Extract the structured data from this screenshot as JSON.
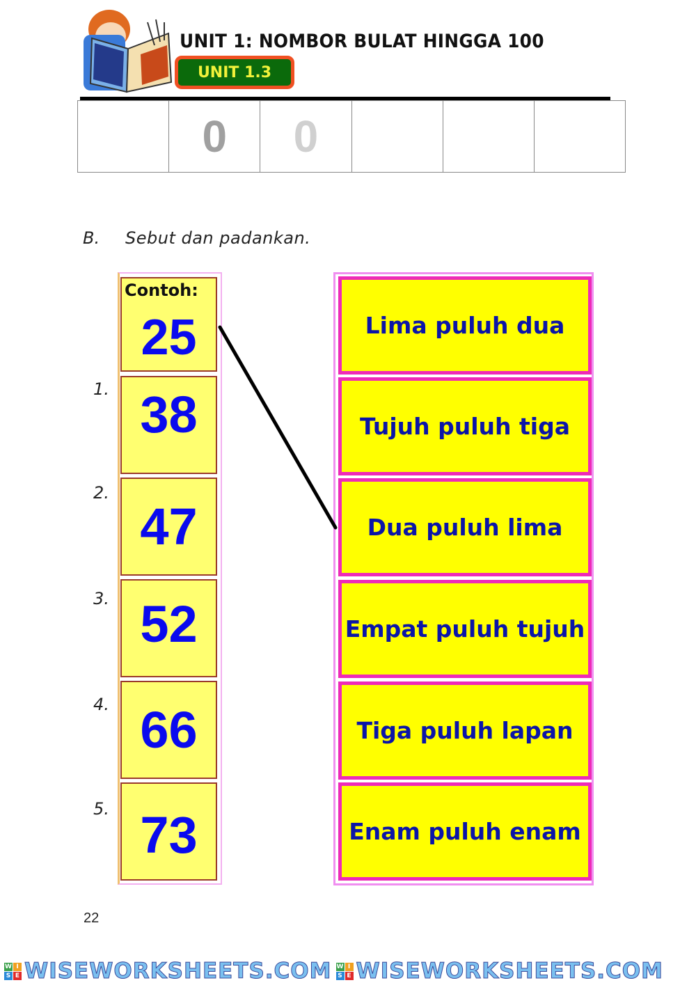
{
  "header": {
    "title": "UNIT 1: NOMBOR BULAT HINGGA 100",
    "badge": "UNIT 1.3",
    "illustration": "boy-reading-book-icon"
  },
  "place_value_table": {
    "cells": [
      "",
      "0",
      "0",
      "",
      "",
      ""
    ],
    "digit_colors": [
      "",
      "#a0a0a0",
      "#d0d0d0",
      "",
      "",
      ""
    ]
  },
  "section": {
    "letter": "B.",
    "instruction": "Sebut dan padankan."
  },
  "example": {
    "label": "Contoh:",
    "number": "25",
    "matched_to": "Dua puluh lima"
  },
  "questions": [
    {
      "index": "1.",
      "number": "38"
    },
    {
      "index": "2.",
      "number": "47"
    },
    {
      "index": "3.",
      "number": "52"
    },
    {
      "index": "4.",
      "number": "66"
    },
    {
      "index": "5.",
      "number": "73"
    }
  ],
  "words": [
    "Lima puluh dua",
    "Tujuh puluh tiga",
    "Dua puluh lima",
    "Empat puluh tujuh",
    "Tiga puluh lapan",
    "Enam puluh enam"
  ],
  "footer": {
    "page_number": "22",
    "watermark": "WISEWORKSHEETS.COM",
    "watermark_logo": [
      "W",
      "I",
      "S",
      "E"
    ]
  },
  "colors": {
    "number_blue": "#0a0aee",
    "word_blue": "#0b15a8",
    "number_box_bg": "#ffff70",
    "word_box_bg": "#ffff00",
    "word_border": "#ee2ab8",
    "badge_green": "#0b6a0b",
    "badge_border": "#f05022",
    "badge_text": "#f2f23a"
  }
}
